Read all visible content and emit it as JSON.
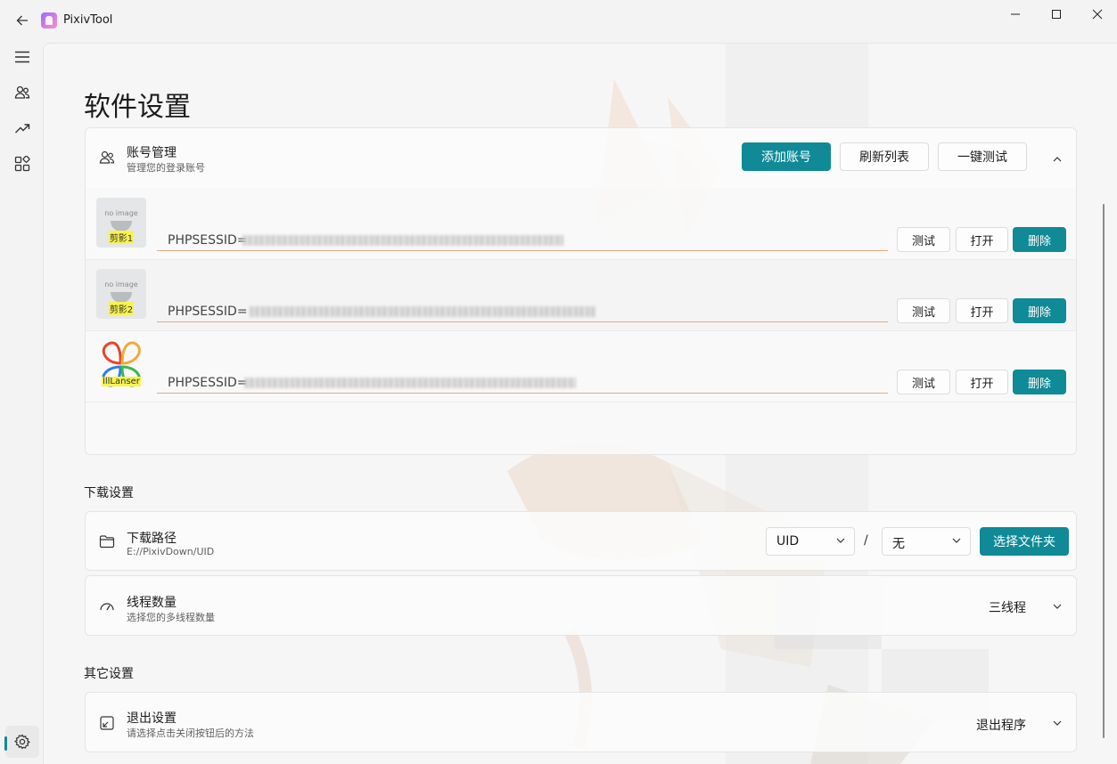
{
  "window": {
    "title": "PixivTool"
  },
  "page": {
    "title": "软件设置"
  },
  "accounts": {
    "title": "账号管理",
    "subtitle": "管理您的登录账号",
    "add_label": "添加账号",
    "refresh_label": "刷新列表",
    "test_all_label": "一键测试",
    "items": [
      {
        "name": "剪影1",
        "session_prefix": "PHPSESSID=",
        "avatar": "no-image",
        "test_label": "测试",
        "open_label": "打开",
        "delete_label": "删除"
      },
      {
        "name": "剪影2",
        "session_prefix": "PHPSESSID=",
        "avatar": "no-image",
        "test_label": "测试",
        "open_label": "打开",
        "delete_label": "删除"
      },
      {
        "name": "lllLanser",
        "session_prefix": "PHPSESSID=",
        "avatar": "clover-logo",
        "test_label": "测试",
        "open_label": "打开",
        "delete_label": "删除"
      }
    ],
    "noimage_text": "no image"
  },
  "download": {
    "section": "下载设置",
    "path_title": "下载路径",
    "path_value": "E://PixivDown/UID",
    "folder_select": "UID",
    "separator": "/",
    "sub_select": "无",
    "choose_label": "选择文件夹",
    "threads_title": "线程数量",
    "threads_subtitle": "选择您的多线程数量",
    "threads_value": "三线程"
  },
  "other": {
    "section": "其它设置",
    "exit_title": "退出设置",
    "exit_subtitle": "请选择点击关闭按钮后的方法",
    "exit_value": "退出程序"
  },
  "colors": {
    "accent": "#0f8a96",
    "underline": "#e7a97d",
    "highlight": "#f7f34d"
  }
}
